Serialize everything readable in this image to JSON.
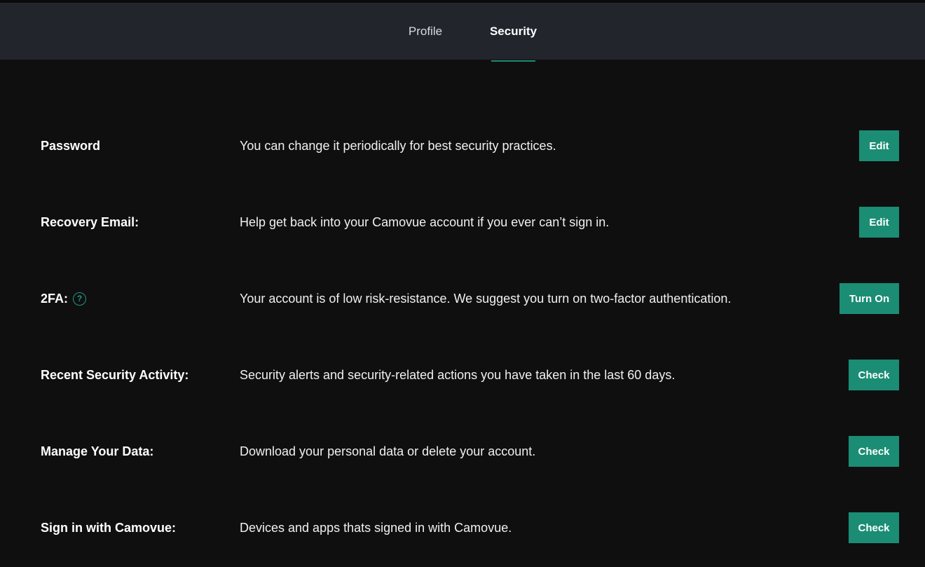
{
  "tabs": {
    "profile": "Profile",
    "security": "Security"
  },
  "rows": [
    {
      "label": "Password",
      "description": "You can change it periodically for best security practices.",
      "button": "Edit"
    },
    {
      "label": "Recovery Email:",
      "description": "Help get back into your Camovue account if you ever can’t sign in.",
      "button": "Edit"
    },
    {
      "label": "2FA:",
      "description": "Your account is of low risk-resistance. We suggest you turn on two-factor authentication.",
      "button": "Turn On",
      "help_icon": "?"
    },
    {
      "label": "Recent Security Activity:",
      "description": "Security alerts and security-related actions you have taken in the last 60 days.",
      "button": "Check"
    },
    {
      "label": "Manage Your Data:",
      "description": "Download your personal data or delete your account.",
      "button": "Check"
    },
    {
      "label": "Sign in with Camovue:",
      "description": "Devices and apps thats signed in with Camovue.",
      "button": "Check"
    }
  ],
  "colors": {
    "background": "#0f0f10",
    "tabbar": "#22252b",
    "accent": "#1b8d74"
  },
  "icons": {
    "help": "question-circle-icon"
  }
}
